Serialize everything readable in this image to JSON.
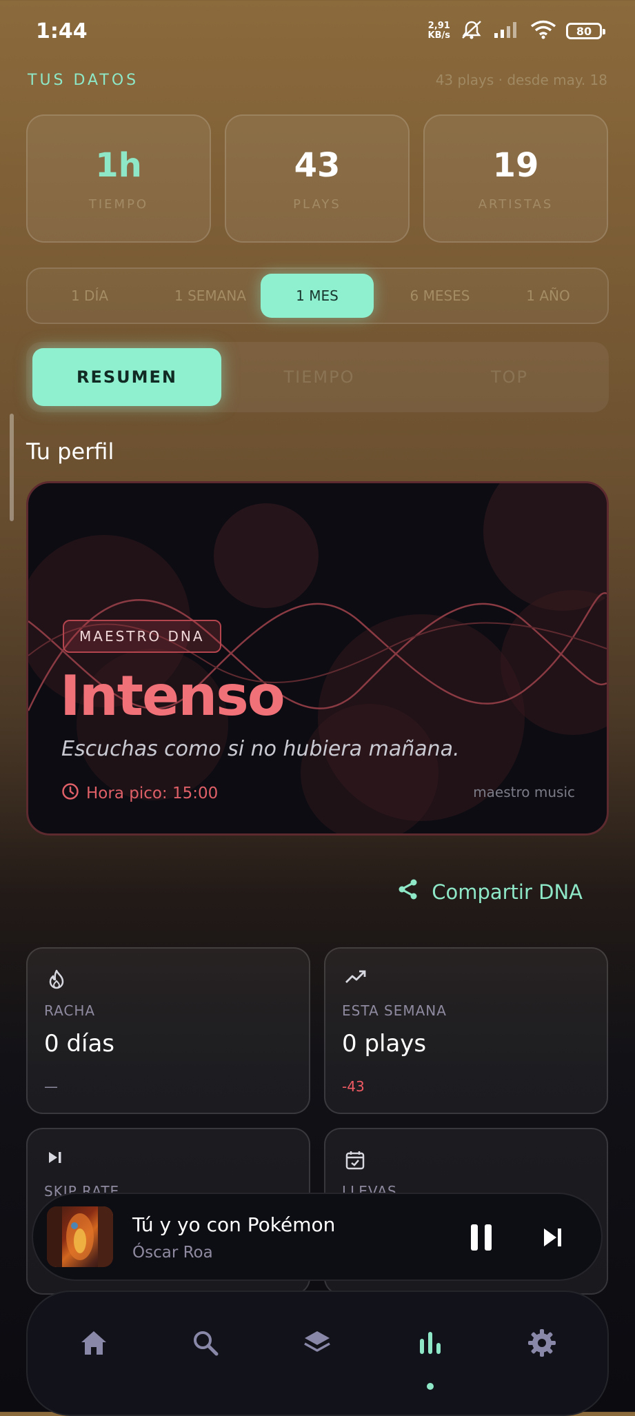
{
  "status_bar": {
    "time": "1:44",
    "speed_value": "2,91",
    "speed_unit": "KB/s",
    "battery": "80"
  },
  "header": {
    "section_label": "TUS DATOS",
    "meta": "43 plays · desde may. 18"
  },
  "stats": [
    {
      "value": "1h",
      "label": "TIEMPO",
      "color": "#8ee8c8"
    },
    {
      "value": "43",
      "label": "PLAYS",
      "color": "#ffffff"
    },
    {
      "value": "19",
      "label": "ARTISTAS",
      "color": "#ffffff"
    }
  ],
  "ranges": [
    "1 DÍA",
    "1 SEMANA",
    "1 MES",
    "6 MESES",
    "1 AÑO"
  ],
  "range_selected": "1 MES",
  "tabs": [
    "RESUMEN",
    "TIEMPO",
    "TOP"
  ],
  "tab_selected": "RESUMEN",
  "profile": {
    "heading": "Tu perfil",
    "badge": "MAESTRO DNA",
    "title": "Intenso",
    "subtitle": "Escuchas como si no hubiera mañana.",
    "peak": "Hora pico: 15:00",
    "brand": "maestro music",
    "accent_color": "#f07178"
  },
  "share": {
    "label": "Compartir DNA"
  },
  "cards": [
    {
      "icon": "flame-icon",
      "label": "RACHA",
      "value": "0 días",
      "delta": "—"
    },
    {
      "icon": "trending-up-icon",
      "label": "ESTA SEMANA",
      "value": "0 plays",
      "delta": "-43",
      "delta_color": "#ef5a63"
    },
    {
      "icon": "skip-next-icon",
      "label": "SKIP RATE"
    },
    {
      "icon": "calendar-check-icon",
      "label": "LLEVAS"
    }
  ],
  "now_playing": {
    "title": "Tú y yo con Pokémon",
    "artist": "Óscar Roa"
  },
  "nav": [
    {
      "icon": "home-icon"
    },
    {
      "icon": "search-icon"
    },
    {
      "icon": "layers-icon"
    },
    {
      "icon": "stats-icon",
      "active": true
    },
    {
      "icon": "settings-icon"
    }
  ],
  "colors": {
    "accent": "#8ee8c8",
    "negative": "#ef5a63"
  }
}
